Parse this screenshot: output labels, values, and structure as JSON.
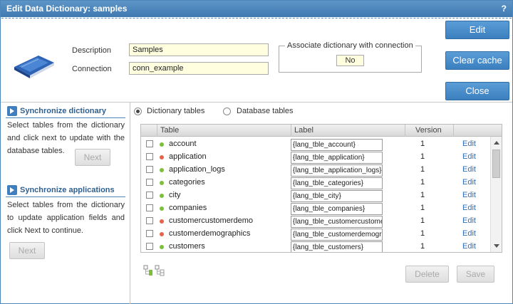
{
  "window": {
    "title": "Edit Data Dictionary: samples",
    "help_glyph": "?"
  },
  "form": {
    "description_label": "Description",
    "description_value": "Samples",
    "connection_label": "Connection",
    "connection_value": "conn_example",
    "assoc_legend": "Associate dictionary with connection",
    "assoc_value": "No"
  },
  "actions": {
    "edit": "Edit",
    "clear_cache": "Clear cache",
    "close": "Close"
  },
  "sync_dict": {
    "title": "Synchronize dictionary",
    "text": "Select tables from the dictionary and click next to update with the database tables.",
    "next": "Next"
  },
  "sync_apps": {
    "title": "Synchronize applications",
    "text": "Select tables from the dictionary to update application fields and click Next to continue.",
    "next": "Next"
  },
  "view": {
    "dictionary_tables": "Dictionary tables",
    "database_tables": "Database tables",
    "selected": "dictionary_tables"
  },
  "grid": {
    "headers": [
      "Table",
      "Label",
      "Version"
    ],
    "rows": [
      {
        "name": "account",
        "label": "{lang_tble_account}",
        "version": "1",
        "edit": "Edit",
        "status": "green"
      },
      {
        "name": "application",
        "label": "{lang_tble_application}",
        "version": "1",
        "edit": "Edit",
        "status": "red"
      },
      {
        "name": "application_logs",
        "label": "{lang_tble_application_logs}",
        "version": "1",
        "edit": "Edit",
        "status": "green"
      },
      {
        "name": "categories",
        "label": "{lang_tble_categories}",
        "version": "1",
        "edit": "Edit",
        "status": "green"
      },
      {
        "name": "city",
        "label": "{lang_tble_city}",
        "version": "1",
        "edit": "Edit",
        "status": "green"
      },
      {
        "name": "companies",
        "label": "{lang_tble_companies}",
        "version": "1",
        "edit": "Edit",
        "status": "green"
      },
      {
        "name": "customercustomerdemo",
        "label": "{lang_tble_customercustomerdemo}",
        "version": "1",
        "edit": "Edit",
        "status": "red"
      },
      {
        "name": "customerdemographics",
        "label": "{lang_tble_customerdemographics}",
        "version": "1",
        "edit": "Edit",
        "status": "red"
      },
      {
        "name": "customers",
        "label": "{lang_tble_customers}",
        "version": "1",
        "edit": "Edit",
        "status": "green"
      }
    ]
  },
  "bottom": {
    "delete": "Delete",
    "save": "Save"
  },
  "colors": {
    "accent": "#3f7fbf",
    "status_green": "#7bbf3a",
    "status_red": "#e4644a",
    "field_bg": "#ffffe0"
  }
}
